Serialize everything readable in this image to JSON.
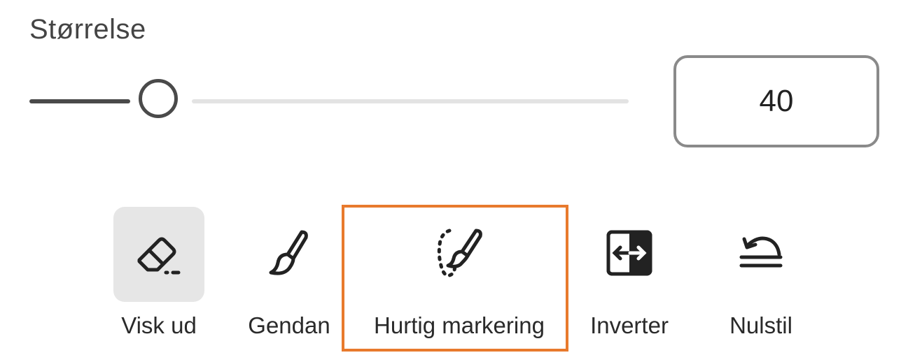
{
  "size": {
    "label": "Størrelse",
    "value": "40",
    "slider_fraction": 0.22
  },
  "tools": [
    {
      "label": "Visk ud",
      "icon": "eraser-icon",
      "selected": true
    },
    {
      "label": "Gendan",
      "icon": "brush-icon",
      "selected": false
    },
    {
      "label": "Hurtig markering",
      "icon": "quick-selection-brush-icon",
      "selected": false,
      "highlighted": true
    },
    {
      "label": "Inverter",
      "icon": "invert-icon",
      "selected": false
    },
    {
      "label": "Nulstil",
      "icon": "reset-icon",
      "selected": false
    }
  ],
  "colors": {
    "highlight": "#e87a2d",
    "selected_bg": "#e6e6e6"
  }
}
